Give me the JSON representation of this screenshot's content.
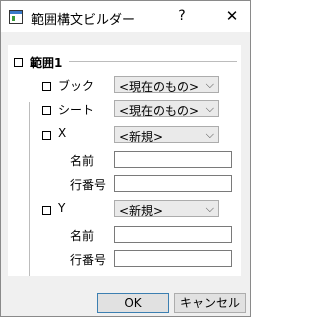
{
  "window": {
    "title": "範囲構文ビルダー",
    "help_label": "?",
    "close_label": "✕"
  },
  "tree": {
    "range_label": "範囲1",
    "book_label": "ブック",
    "book_value": "<現在のもの>",
    "sheet_label": "シート",
    "sheet_value": "<現在のもの>",
    "x_label": "X",
    "x_value": "<新規>",
    "x_name_label": "名前",
    "x_row_label": "行番号",
    "x_name_value": "",
    "x_row_value": "",
    "y_label": "Y",
    "y_value": "<新規>",
    "y_name_label": "名前",
    "y_row_label": "行番号",
    "y_name_value": "",
    "y_row_value": ""
  },
  "buttons": {
    "ok": "OK",
    "cancel": "キャンセル"
  }
}
